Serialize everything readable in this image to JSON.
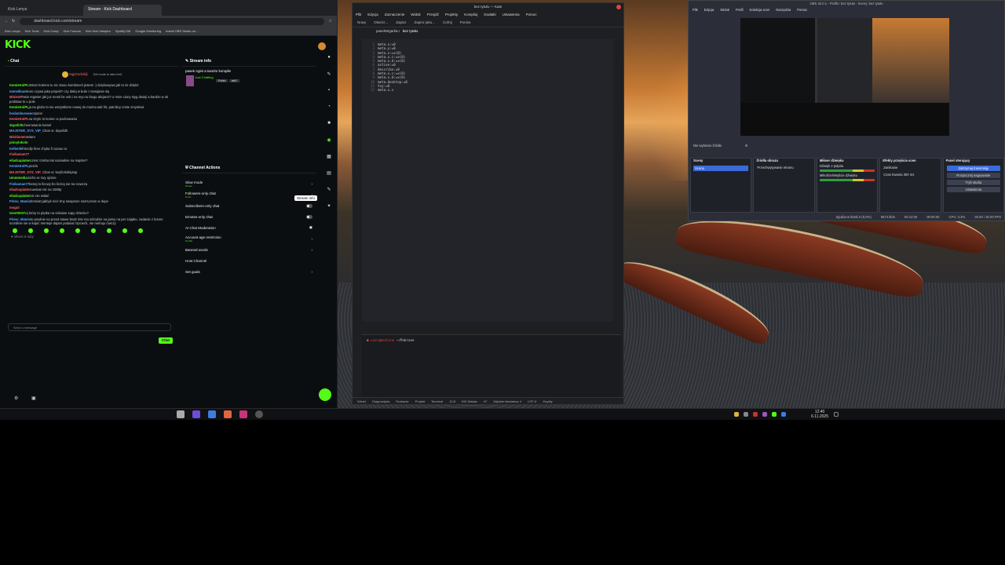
{
  "browser": {
    "tabs": [
      "Kick Lenya",
      "Stream - Kick Dashboard"
    ],
    "url": "dashboard.kick.com/stream",
    "bookmarks": [
      "Kick Lenya",
      "Kick Tools",
      "Kick Crazy",
      "Kick Forums",
      "Kick Kick Vampire",
      "Spotify DM",
      "Google Monitoring",
      "Install OBS Studio on..."
    ],
    "logo": "KICK"
  },
  "chat": {
    "title": "Chat",
    "pinned_user": "Sqpzrodzikiji",
    "pinned_text": "Set mode to take limit",
    "messages": [
      {
        "user": "KemieKolPL",
        "text": "Wiesz kolerne tu nic stanu kombinerii jestem :) dziękowywa jak to że dzięki!"
      },
      {
        "user": "meneilkas",
        "text": "skoro czywa jaka projekt? czy dalej w bule i rozwijanie się"
      },
      {
        "user": "Miniest",
        "text": "Pasie regatrer jak juz mosti he vob i na myo tu kiego akcjami? U mnie ciony styg dwieji a bardzo w ok podstaw to u pole"
      },
      {
        "user": "KemieKolPL",
        "text": "ja na glubo to nie wszystkiem nowej do można taki firt, patnikcy coste zmyslowi"
      },
      {
        "user": "bodamkurawec",
        "text": "spoon"
      },
      {
        "user": "KemieKolPL",
        "text": "na trzyle to koniec w podcowaniu"
      },
      {
        "user": "dupeli3h",
        "text": "cheerowanie kamel"
      },
      {
        "user": "MAJSTER_SYS_VIP_C",
        "text": "bon w: dupeli3h"
      },
      {
        "user": "Misidunem",
        "text": "witam"
      },
      {
        "user": "pinoylokolo",
        "text": ""
      },
      {
        "user": "Kellenfe",
        "text": "friendly firee chyba fi cozaw co"
      },
      {
        "user": "Fisikaman77",
        "text": ""
      },
      {
        "user": "eliadcapiaten",
        "text": "czesc trzeba tak nazwalnie na majster?"
      },
      {
        "user": "KemieKolPL",
        "text": "pozdo"
      },
      {
        "user": "MAJSTER_SYS_VIP_C",
        "text": "bon w: keyfiorlulkiptop"
      },
      {
        "user": "Ummmedia",
        "text": "micho w: twy ojcinie"
      },
      {
        "user": "Fisikaman77",
        "text": "benej to fiecwy bo licrzoj sie nie nowcza"
      },
      {
        "user": "eliadcapiaten",
        "text": "cuesiae nie na 1080p"
      },
      {
        "user": "eliadcapiaten",
        "text": "nic nie widać"
      },
      {
        "user": "Pinno_Mamix",
        "text": "bmniatt jakbyś nicé trny swojarion nazm,teion w dupe"
      },
      {
        "user": "mogul",
        "text": ""
      },
      {
        "user": "Geert0007",
        "text": "a) który to piętka na ciekawe zapy dziecko?"
      },
      {
        "user": "Pinno_Mamix",
        "text": "to powinie na przed stawe bratz inte ma schodzie na jasny na per zajątku. zadanie z konne scordinie sie w kupić mentoje dajam podaiać Opciech, nie mehoju ćwiczy"
      }
    ],
    "reply_hint": "♥ others is ruby",
    "input_placeholder": "Send a message",
    "send_label": "Chat"
  },
  "stream_info": {
    "title": "Stream info",
    "stream_title": "pasek Agini a tworim kompile",
    "category": "Just Chatting",
    "tags": [
      "Polish",
      "attr2"
    ]
  },
  "channel_actions": {
    "title": "Channel Actions",
    "rows": [
      {
        "label": "Slow mode",
        "sub": "10 sec",
        "control": "chevron"
      },
      {
        "label": "Followers-only chat",
        "sub": "0 min",
        "control": "chevron"
      },
      {
        "label": "Subscribers-only chat",
        "sub": "",
        "control": "toggle"
      },
      {
        "label": "Emotes-only chat",
        "sub": "",
        "control": "toggle"
      },
      {
        "label": "AI Chat Moderation",
        "sub": "",
        "control": "icon"
      },
      {
        "label": "Account age restriction",
        "sub": "6 mths",
        "control": "chevron"
      },
      {
        "label": "Banned words",
        "sub": "",
        "control": "chevron"
      },
      {
        "label": "Host Channel",
        "sub": "",
        "control": "none"
      },
      {
        "label": "Set goals",
        "sub": "",
        "control": "chevron"
      }
    ],
    "tooltip": "Stream info"
  },
  "kate": {
    "title": "bez tytułu — Kate",
    "menu": [
      "Plik",
      "Edycja",
      "Zaznaczenie",
      "Widok",
      "Przejdź",
      "Projekty",
      "Kompiluj",
      "Dodatki",
      "Ustawienia",
      "Pomoc"
    ],
    "toolbar": [
      "Nowy",
      "Otwórz...",
      "Zapisz",
      "Zapisz jako...",
      "Cofnij",
      "Ponów"
    ],
    "tabs": [
      "pasekWgarkiLI",
      "bez tytułu"
    ],
    "code": [
      "meta.x:=0",
      "meta.y:=0",
      "meta.x:=x(0)",
      "meta.x.c:=x(0)",
      "meta.x.d:=x(0)",
      "active:=0",
      "describe:=0",
      "meta.x.c:=x(0)",
      "meta.x.d:=x(0)",
      "meta.desktop:=0",
      "tvy:=0",
      "meta.x.x"
    ],
    "terminal_prompt": "~/Pobrane",
    "status": [
      "Wiedź",
      "Diagnostyka",
      "Szukanie",
      "Projekt",
      "Terminal",
      "12:8",
      "INS Wstaw",
      "LF",
      "Miękkie tabulatory 4",
      "UTF-8",
      "Zwykły"
    ]
  },
  "obs": {
    "title": "OBS 32.0.1 - Profile: bez tytułu - Sceny: bez tytułu",
    "menu": [
      "Plik",
      "Edycja",
      "Widok",
      "Profil",
      "Kolekcja scen",
      "Narzędzia",
      "Pomoc"
    ],
    "no_source": "Nie wybrano źródła",
    "docks": {
      "scenes": {
        "title": "Sceny",
        "items": [
          "Scena"
        ]
      },
      "sources": {
        "title": "Źródła obrazu",
        "items": [
          "Przechwytywanie ekranu"
        ]
      },
      "mixer": {
        "title": "Mikser dźwięku",
        "items": [
          "Dźwięk z pulpitu",
          "Mikrofon/Wejście dźwięku"
        ]
      },
      "transitions": {
        "title": "Efekty przejścia scen",
        "items": [
          "Zanikanie",
          "Czas trwania"
        ],
        "duration": "300 ms"
      },
      "controls": {
        "title": "Panel sterujący",
        "items": [
          "Zatrzymaj transmisję",
          "Rozpocznij nagrywanie",
          "Tryb studia",
          "Ustawienia"
        ]
      }
    },
    "status": [
      "Zgubione klatki 0 (0,0%)",
      "5673 kb/s",
      "00:12:06",
      "00:00:00",
      "CPU: 3,3%",
      "30.00 / 30.00 FPS"
    ]
  },
  "taskbar": {
    "time": "12:40",
    "date": "6.11.2025"
  }
}
